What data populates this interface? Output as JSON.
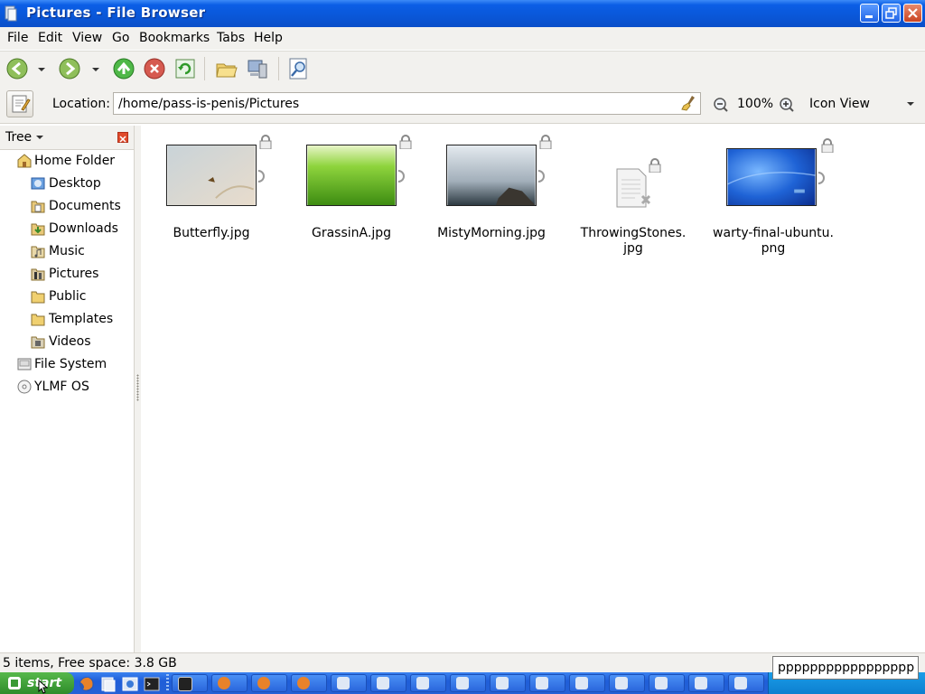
{
  "window": {
    "title": "Pictures - File Browser"
  },
  "menu": {
    "items": [
      {
        "label": "File"
      },
      {
        "label": "Edit"
      },
      {
        "label": "View"
      },
      {
        "label": "Go"
      },
      {
        "label": "Bookmarks"
      },
      {
        "label": "Tabs"
      },
      {
        "label": "Help"
      }
    ]
  },
  "toolbar": {
    "buttons": [
      "back-icon",
      "forward-icon",
      "up-icon",
      "stop-icon",
      "reload-icon",
      "home-folder-icon",
      "computer-icon",
      "search-icon"
    ]
  },
  "location": {
    "label": "Location:",
    "path": "/home/pass-is-penis/Pictures",
    "zoom": "100%",
    "view_mode": "Icon View"
  },
  "sidebar": {
    "title": "Tree",
    "items": [
      {
        "label": "Home Folder",
        "icon": "home-icon",
        "expanded": true
      },
      {
        "label": "Desktop",
        "icon": "desktop-folder-icon"
      },
      {
        "label": "Documents",
        "icon": "documents-folder-icon"
      },
      {
        "label": "Downloads",
        "icon": "downloads-folder-icon"
      },
      {
        "label": "Music",
        "icon": "music-folder-icon"
      },
      {
        "label": "Pictures",
        "icon": "pictures-folder-icon"
      },
      {
        "label": "Public",
        "icon": "folder-icon"
      },
      {
        "label": "Templates",
        "icon": "folder-icon"
      },
      {
        "label": "Videos",
        "icon": "videos-folder-icon"
      },
      {
        "label": "File System",
        "icon": "drive-icon"
      },
      {
        "label": "YLMF OS",
        "icon": "disc-icon"
      }
    ]
  },
  "files": [
    {
      "name": "Butterfly.jpg"
    },
    {
      "name": "GrassinA.jpg"
    },
    {
      "name": "MistyMorning.jpg"
    },
    {
      "name": "ThrowingStones.\njpg"
    },
    {
      "name": "warty-final-ubuntu.\npng"
    }
  ],
  "status": {
    "text": "5 items, Free space: 3.8 GB"
  },
  "typeahead": {
    "value": "pppppppppppppppppp"
  },
  "taskbar": {
    "start_label": "start"
  },
  "colors": {
    "titlebar": "#0a57d8",
    "taskbar": "#2561d6",
    "start": "#3a9a35"
  }
}
